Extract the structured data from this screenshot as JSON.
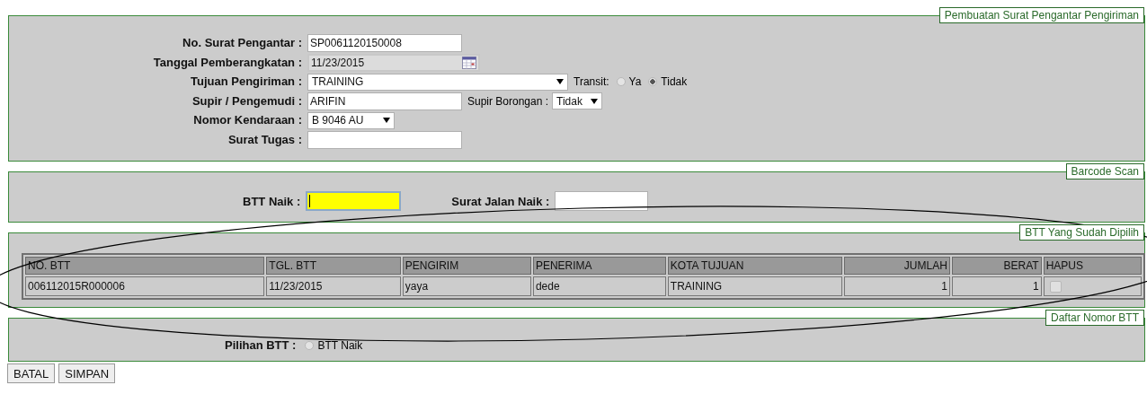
{
  "shipment_form": {
    "legend": "Pembuatan Surat Pengantar Pengiriman",
    "rows": [
      {
        "label": "No. Surat Pengantar :",
        "kind": "text",
        "value": "SP0061120150008"
      },
      {
        "label": "Tanggal Pemberangkatan :",
        "kind": "date",
        "value": "11/23/2015"
      },
      {
        "label": "Tujuan Pengiriman :",
        "kind": "wide-select",
        "value": "TRAINING",
        "extra": {
          "kind": "radio",
          "label": "Transit:",
          "options": [
            {
              "label": "Ya",
              "selected": false
            },
            {
              "label": "Tidak",
              "selected": true
            }
          ]
        }
      },
      {
        "label": "Supir / Pengemudi :",
        "kind": "text",
        "value": "ARIFIN",
        "extra": {
          "kind": "select",
          "label": "Supir Borongan :",
          "value": "Tidak"
        }
      },
      {
        "label": "Nomor Kendaraan :",
        "kind": "select",
        "value": "B 9046 AU"
      },
      {
        "label": "Surat Tugas :",
        "kind": "text"
      }
    ]
  },
  "barcode_scan": {
    "legend": "Barcode Scan",
    "fields": [
      {
        "label": "BTT Naik :",
        "focused": true
      },
      {
        "label": "Surat Jalan Naik :",
        "focused": false
      }
    ]
  },
  "selected_btt": {
    "legend": "BTT Yang Sudah Dipilih",
    "table": {
      "columns": [
        {
          "label": "NO. BTT",
          "numeric": false
        },
        {
          "label": "TGL. BTT",
          "numeric": false
        },
        {
          "label": "PENGIRIM",
          "numeric": false
        },
        {
          "label": "PENERIMA",
          "numeric": false
        },
        {
          "label": "KOTA TUJUAN",
          "numeric": false
        },
        {
          "label": "JUMLAH",
          "numeric": true
        },
        {
          "label": "BERAT",
          "numeric": true
        },
        {
          "label": "HAPUS",
          "numeric": false
        }
      ],
      "rows": [
        {
          "cells": [
            "006112015R000006",
            "11/23/2015",
            "yaya",
            "dede",
            "TRAINING",
            "1",
            "1"
          ],
          "delete_checked": false
        }
      ]
    }
  },
  "btt_list": {
    "legend": "Daftar Nomor BTT",
    "label": "Pilihan BTT :",
    "options": [
      {
        "label": "BTT Naik",
        "selected": false
      }
    ]
  },
  "buttons": [
    "BATAL",
    "SIMPAN"
  ]
}
